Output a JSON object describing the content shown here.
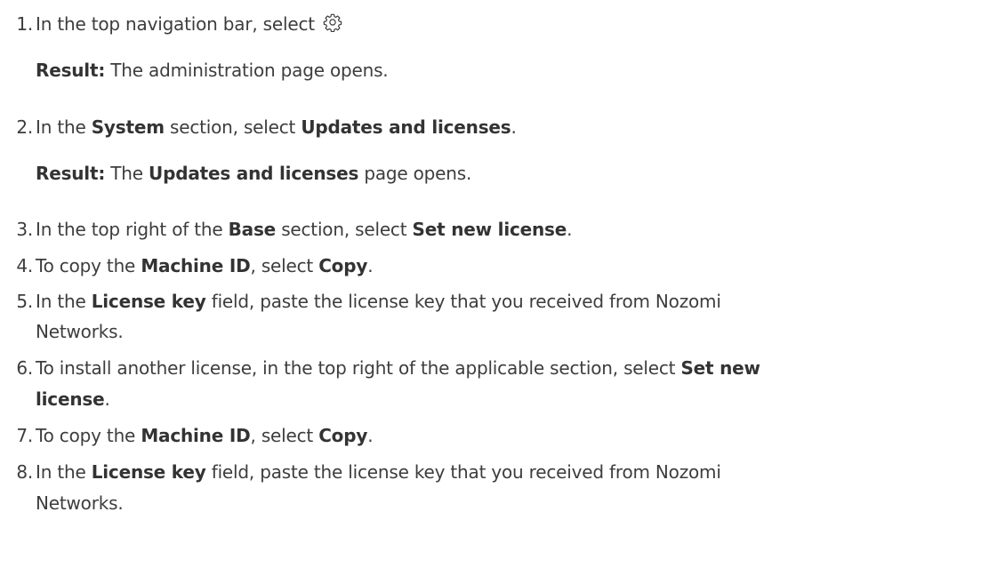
{
  "steps": [
    {
      "num": "1.",
      "pre": "In the top navigation bar, select",
      "icon": "gear-icon",
      "result": {
        "label": "Result:",
        "text": " The administration page opens."
      }
    },
    {
      "num": "2.",
      "pre": "In the ",
      "b1": "System",
      "mid": " section, select ",
      "b2": "Updates and licenses",
      "post": ".",
      "result": {
        "label": "Result:",
        "pre": " The ",
        "bold": "Updates and licenses",
        "post": " page opens."
      }
    },
    {
      "num": "3.",
      "pre": "In the top right of the ",
      "b1": "Base",
      "mid": " section, select ",
      "b2": "Set new license",
      "post": "."
    },
    {
      "num": "4.",
      "pre": "To copy the ",
      "b1": "Machine ID",
      "mid": ", select ",
      "b2": "Copy",
      "post": "."
    },
    {
      "num": "5.",
      "pre": "In the ",
      "b1": "License key",
      "mid": " field, paste the license key that you received from Nozomi",
      "cont": "Networks."
    },
    {
      "num": "6.",
      "pre": "To install another license, in the top right of the applicable section, select ",
      "b1": "Set new",
      "cont_b": "license",
      "cont_post": "."
    },
    {
      "num": "7.",
      "pre": "To copy the ",
      "b1": "Machine ID",
      "mid": ", select ",
      "b2": "Copy",
      "post": "."
    },
    {
      "num": "8.",
      "pre": "In the ",
      "b1": "License key",
      "mid": " field, paste the license key that you received from Nozomi",
      "cont": "Networks."
    }
  ]
}
